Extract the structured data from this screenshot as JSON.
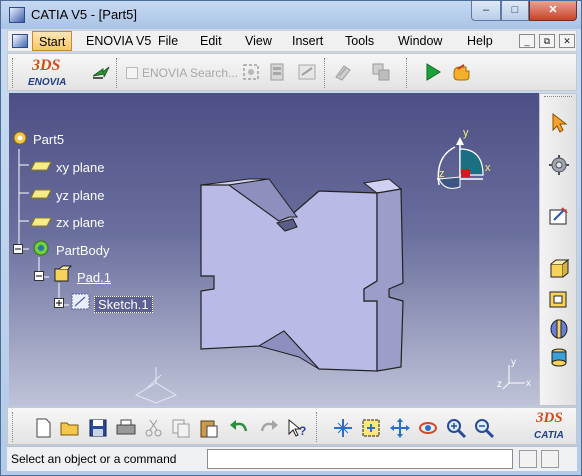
{
  "window": {
    "title": "CATIA V5 - [Part5]"
  },
  "window_controls": {
    "minimize": "–",
    "maximize": "□",
    "close": "✕"
  },
  "menubar": {
    "items": [
      "Start",
      "ENOVIA V5",
      "File",
      "Edit",
      "View",
      "Insert",
      "Tools",
      "Window",
      "Help"
    ],
    "active": "Start",
    "mdi_controls": [
      "_",
      "⧉",
      "✕"
    ]
  },
  "top_toolbar": {
    "enovia_logo": {
      "mark": "3DS",
      "text": "ENOVIA"
    },
    "enovia_search": "ENOVIA Search..."
  },
  "tree": {
    "root": "Part5",
    "planes": [
      "xy plane",
      "yz plane",
      "zx plane"
    ],
    "body": "PartBody",
    "pad": "Pad.1",
    "sketch": "Sketch.1"
  },
  "compass": {
    "x": "x",
    "y": "y",
    "z": "z"
  },
  "axis_corner": {
    "x": "x",
    "y": "y",
    "z": "z"
  },
  "bottom_toolbar": {
    "catia_logo": {
      "mark": "3DS",
      "text": "CATIA"
    }
  },
  "statusbar": {
    "message": "Select an object or a command",
    "command_input_value": ""
  },
  "colors": {
    "viewport_top": "#4c4f84",
    "viewport_bottom": "#bfc3d8",
    "part_face": "#b9bae6",
    "part_dark": "#9c9dc9",
    "menu_highlight": "#f8c766"
  },
  "icons": {
    "top_toolbar": [
      "enovia-logo-icon",
      "enovia-arrow-icon",
      "enovia-search-checkbox",
      "enovia-tool-1-icon",
      "enovia-tool-2-icon",
      "enovia-tool-3-icon",
      "enovia-tool-4-icon",
      "enovia-tool-5-icon",
      "play-icon",
      "macro-hand-icon"
    ],
    "right_toolbar": [
      "select-arrow-icon",
      "gear-icon",
      "sketch-icon",
      "pad-icon",
      "pocket-icon",
      "shaft-icon",
      "hole-icon"
    ],
    "bottom_toolbar": [
      "new-icon",
      "open-icon",
      "save-icon",
      "print-icon",
      "cut-icon",
      "copy-icon",
      "paste-icon",
      "undo-icon",
      "redo-icon",
      "whats-this-icon",
      "fly-icon",
      "fit-all-icon",
      "pan-icon",
      "rotate-icon",
      "zoom-in-icon",
      "zoom-out-icon",
      "catia-logo-icon"
    ]
  }
}
